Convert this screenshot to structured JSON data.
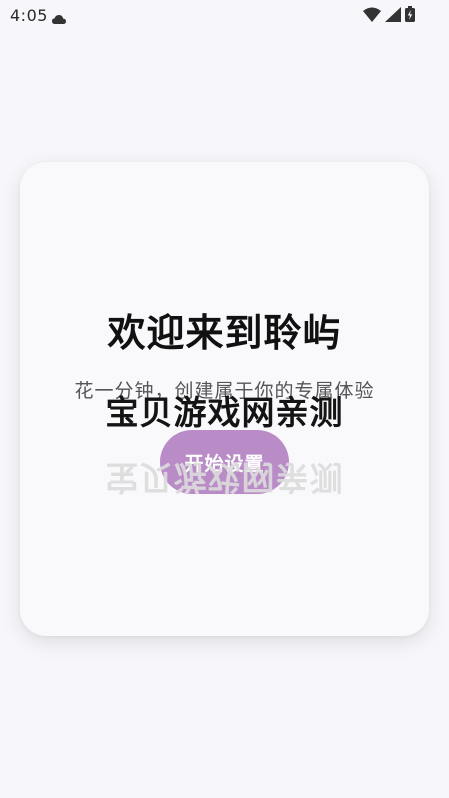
{
  "status_bar": {
    "time": "4:05",
    "icons": [
      "cloud-icon",
      "wifi-icon",
      "signal-icon",
      "battery-icon"
    ]
  },
  "welcome_card": {
    "title": "欢迎来到聆屿",
    "subtitle": "花一分钟，创建属于你的专属体验",
    "button_label": "开始设置",
    "button_color": "#b98bc7"
  },
  "watermark": {
    "text": "宝贝游戏网亲测"
  }
}
